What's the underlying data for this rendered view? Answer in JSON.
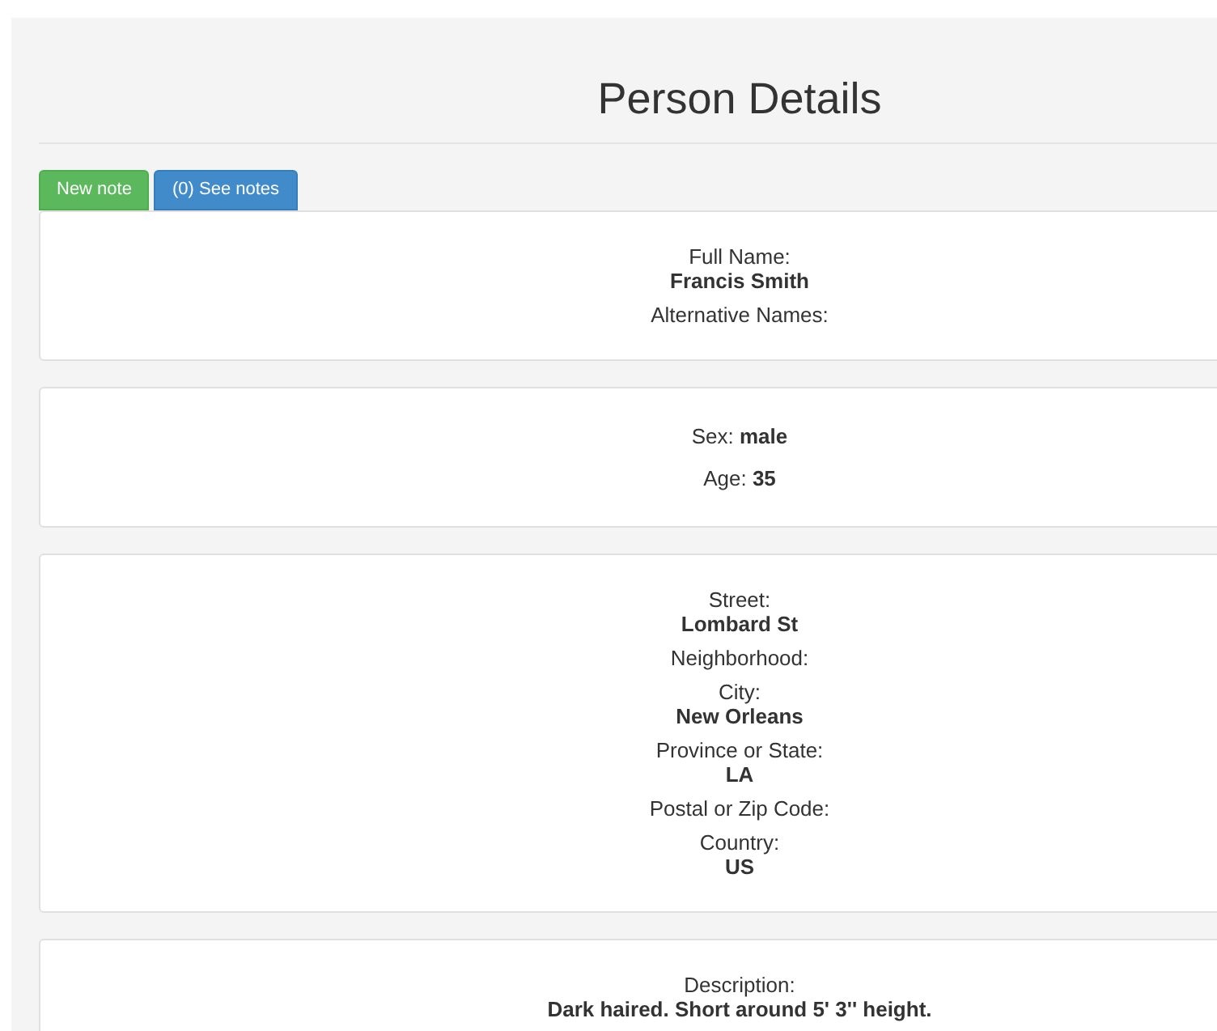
{
  "title": "Person Details",
  "buttons": [
    {
      "label": "New note",
      "kind": "success"
    },
    {
      "label": "(0) See notes",
      "kind": "primary"
    }
  ],
  "cards": [
    {
      "fields": [
        {
          "label": "Full Name:",
          "value": "Francis Smith",
          "kind": "stacked"
        },
        {
          "label": "Alternative Names:",
          "kind": "stacked"
        }
      ]
    },
    {
      "fields": [
        {
          "label": "Sex:",
          "value": "male",
          "kind": "inline"
        },
        {
          "label": "Age:",
          "value": "35",
          "kind": "inline"
        }
      ]
    },
    {
      "fields": [
        {
          "label": "Street:",
          "value": "Lombard St",
          "kind": "stacked"
        },
        {
          "label": "Neighborhood:",
          "kind": "stacked"
        },
        {
          "label": "City:",
          "value": "New Orleans",
          "kind": "stacked"
        },
        {
          "label": "Province or State:",
          "value": "LA",
          "kind": "stacked"
        },
        {
          "label": "Postal or Zip Code:",
          "kind": "stacked"
        },
        {
          "label": "Country:",
          "value": "US",
          "kind": "stacked"
        }
      ]
    },
    {
      "fields": [
        {
          "label": "Description:",
          "value": "Dark haired. Short around 5' 3'' height.",
          "kind": "stacked"
        }
      ]
    }
  ]
}
